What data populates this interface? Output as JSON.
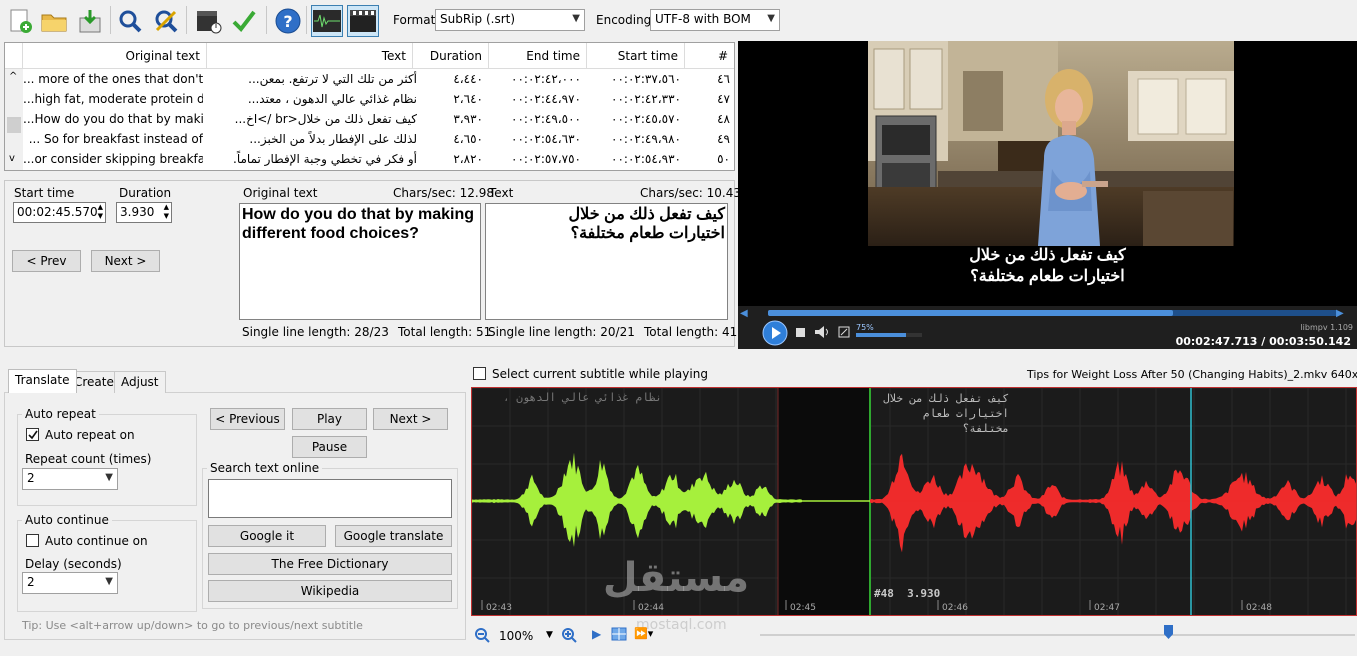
{
  "toolbar": {
    "format_label": "Format",
    "format_value": "SubRip (.srt)",
    "encoding_label": "Encoding",
    "encoding_value": "UTF-8 with BOM"
  },
  "grid": {
    "headers": {
      "original": "Original text",
      "text": "Text",
      "duration": "Duration",
      "end": "End time",
      "start": "Start time",
      "num": "#"
    },
    "rows": [
      {
        "original": "... more of the ones that don't",
        "text": "أكثر من تلك التي لا ترتفع.  بمعن...",
        "duration": "٤،٤٤٠",
        "end": "٠٠:٠٢:٤٢،٠٠٠",
        "start": "٠٠:٠٢:٣٧،٥٦٠",
        "num": "٤٦"
      },
      {
        "original": "...high fat, moderate protein d",
        "text": "نظام غذائي عالي الدهون ، معتد...",
        "duration": "٢،٦٤٠",
        "end": "٠٠:٠٢:٤٤،٩٧٠",
        "start": "٠٠:٠٢:٤٢،٣٣٠",
        "num": "٤٧"
      },
      {
        "original": "...How do you do that by maki",
        "text": "كيف تفعل ذلك من خلال<br />اخ...",
        "duration": "٣،٩٣٠",
        "end": "٠٠:٠٢:٤٩،٥٠٠",
        "start": "٠٠:٠٢:٤٥،٥٧٠",
        "num": "٤٨"
      },
      {
        "original": "... So for breakfast instead of",
        "text": "لذلك على الإفطار بدلاً من الخبز...",
        "duration": "٤،٦٥٠",
        "end": "٠٠:٠٢:٥٤،٦٣٠",
        "start": "٠٠:٠٢:٤٩،٩٨٠",
        "num": "٤٩"
      },
      {
        "original": "...or consider skipping breakfa",
        "text": "أو فكر في تخطي وجبة الإفطار تماماً.",
        "duration": "٢،٨٢٠",
        "end": "٠٠:٠٢:٥٧،٧٥٠",
        "start": "٠٠:٠٢:٥٤،٩٣٠",
        "num": "٥٠"
      }
    ]
  },
  "edit": {
    "start_label": "Start time",
    "start_value": "00:02:45.570",
    "duration_label": "Duration",
    "duration_value": "3.930",
    "prev": "< Prev",
    "next": "Next >",
    "orig_label": "Original text",
    "orig_cps": "Chars/sec: 12.98",
    "orig_text": "How do you do that by making\ndifferent food choices?",
    "orig_single": "Single line length: 28/23",
    "orig_total": "Total length: 51",
    "text_label": "Text",
    "text_cps": "Chars/sec: 10.43",
    "text_text": "كيف تفعل ذلك من خلال\nاختيارات طعام مختلفة؟",
    "text_single": "Single line length: 20/21",
    "text_total": "Total length: 41"
  },
  "video": {
    "subtitle_line1": "كيف تفعل ذلك من خلال",
    "subtitle_line2": "اختيارات طعام مختلفة؟",
    "volume": "75%",
    "player": "libmpv 1.109",
    "time": "00:02:47.713 / 00:03:50.142"
  },
  "tabs": {
    "translate": "Translate",
    "create": "Create",
    "adjust": "Adjust"
  },
  "translate": {
    "auto_repeat_group": "Auto repeat",
    "auto_repeat_on": "Auto repeat on",
    "repeat_count_label": "Repeat count (times)",
    "repeat_count_value": "2",
    "auto_continue_group": "Auto continue",
    "auto_continue_on": "Auto continue on",
    "delay_label": "Delay (seconds)",
    "delay_value": "2",
    "previous": "< Previous",
    "play": "Play",
    "next": "Next >",
    "pause": "Pause",
    "search_group": "Search text online",
    "google_it": "Google it",
    "google_translate": "Google translate",
    "free_dictionary": "The Free Dictionary",
    "wikipedia": "Wikipedia",
    "tip": "Tip: Use <alt+arrow up/down> to go to previous/next subtitle"
  },
  "waveform": {
    "select_current": "Select current subtitle while playing",
    "file_info": "Tips for Weight Loss After 50 (Changing Habits)_2.mkv 640x360",
    "prev_sub_text": "نظام غذائي عالي الدهون ،",
    "cur_sub_line1": "كيف تفعل ذلك من خلال",
    "cur_sub_line2": "اختيارات طعام مختلفة؟",
    "cur_label": "#48  3.930",
    "ticks": [
      "02:43",
      "02:44",
      "02:45",
      "02:46",
      "02:47",
      "02:48"
    ],
    "zoom": "100%"
  },
  "watermark": {
    "brand_ar": "مستقل",
    "brand_url": "mostaql.com"
  },
  "colors": {
    "green_wave": "#a6f03c",
    "red_wave": "#ee2b2b",
    "grid_line": "#3a3a3a",
    "playhead": "#30c0d0"
  }
}
